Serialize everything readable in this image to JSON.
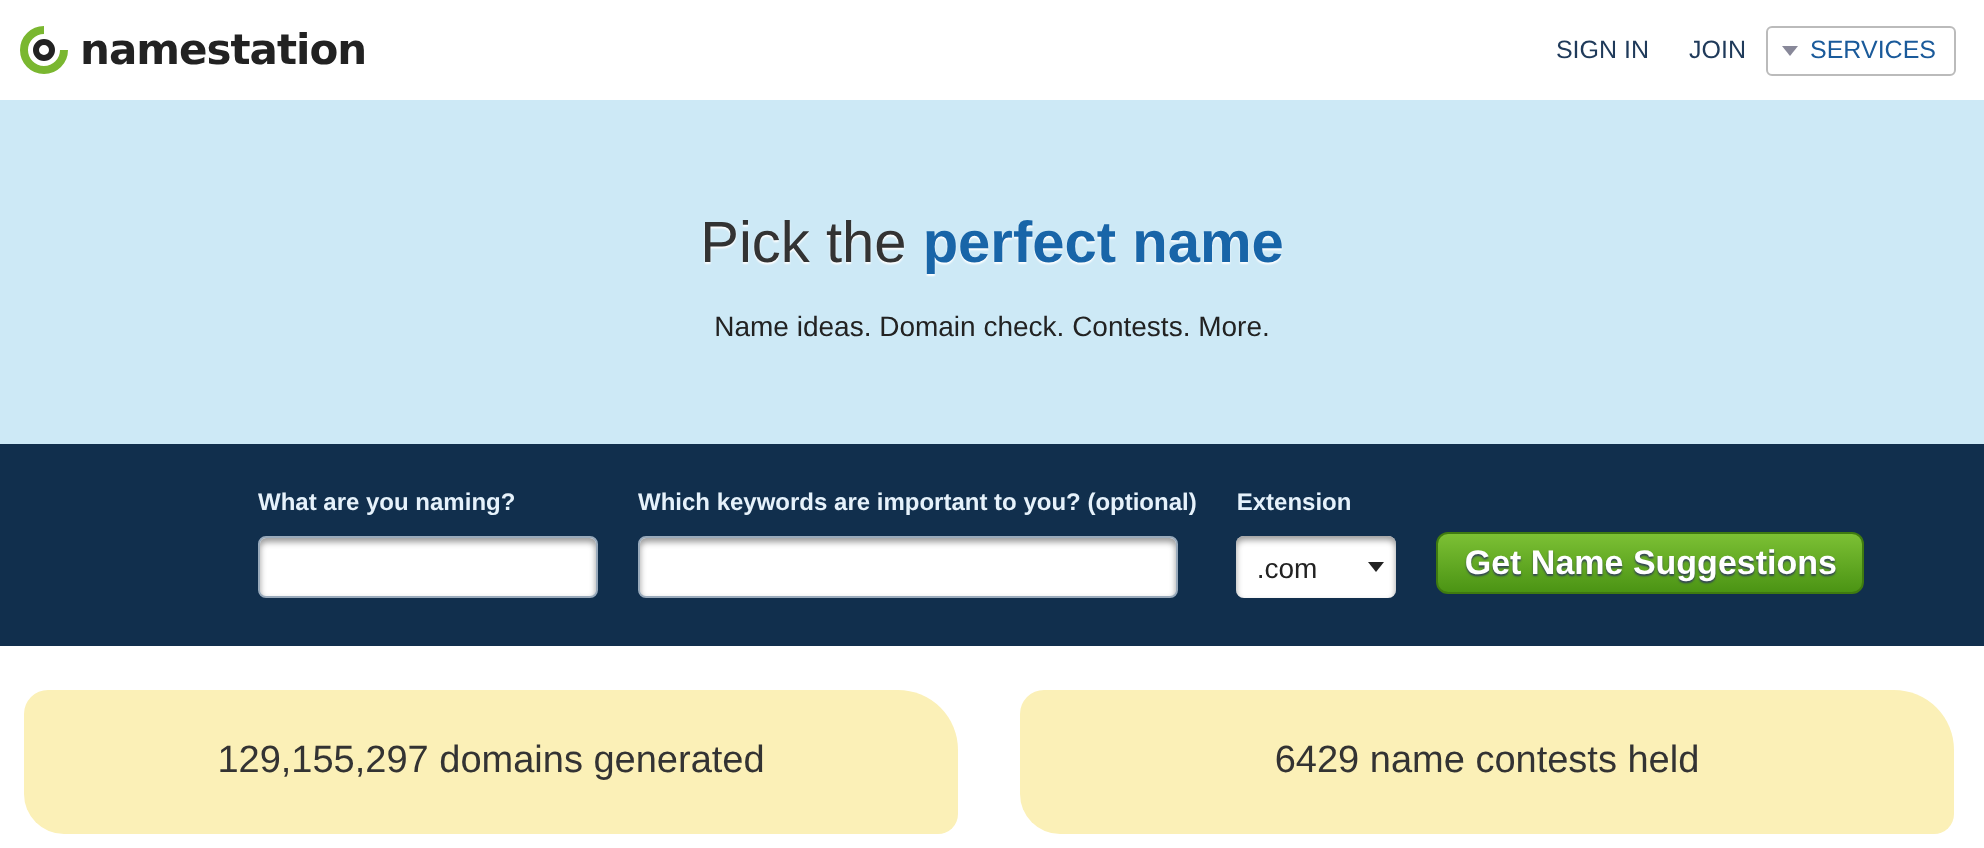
{
  "header": {
    "logo": "namestation",
    "nav": [
      {
        "label": "SIGN IN",
        "kind": "link"
      },
      {
        "label": "JOIN",
        "kind": "link"
      },
      {
        "label": "SERVICES",
        "kind": "dropdown"
      }
    ]
  },
  "hero": {
    "title": "Pick the **perfect name**",
    "subtitle": "Name ideas. Domain check. Contests. More."
  },
  "form": {
    "fields": [
      {
        "label": "What are you naming?",
        "kind": "narrow"
      },
      {
        "label": "Which keywords are important to you? (optional)",
        "kind": "wide"
      },
      {
        "label": "Extension",
        "kind": "select",
        "value": ".com"
      }
    ],
    "button": "Get Name Suggestions"
  },
  "stats": [
    "129,155,297 domains generated",
    "6429 name contests held"
  ]
}
